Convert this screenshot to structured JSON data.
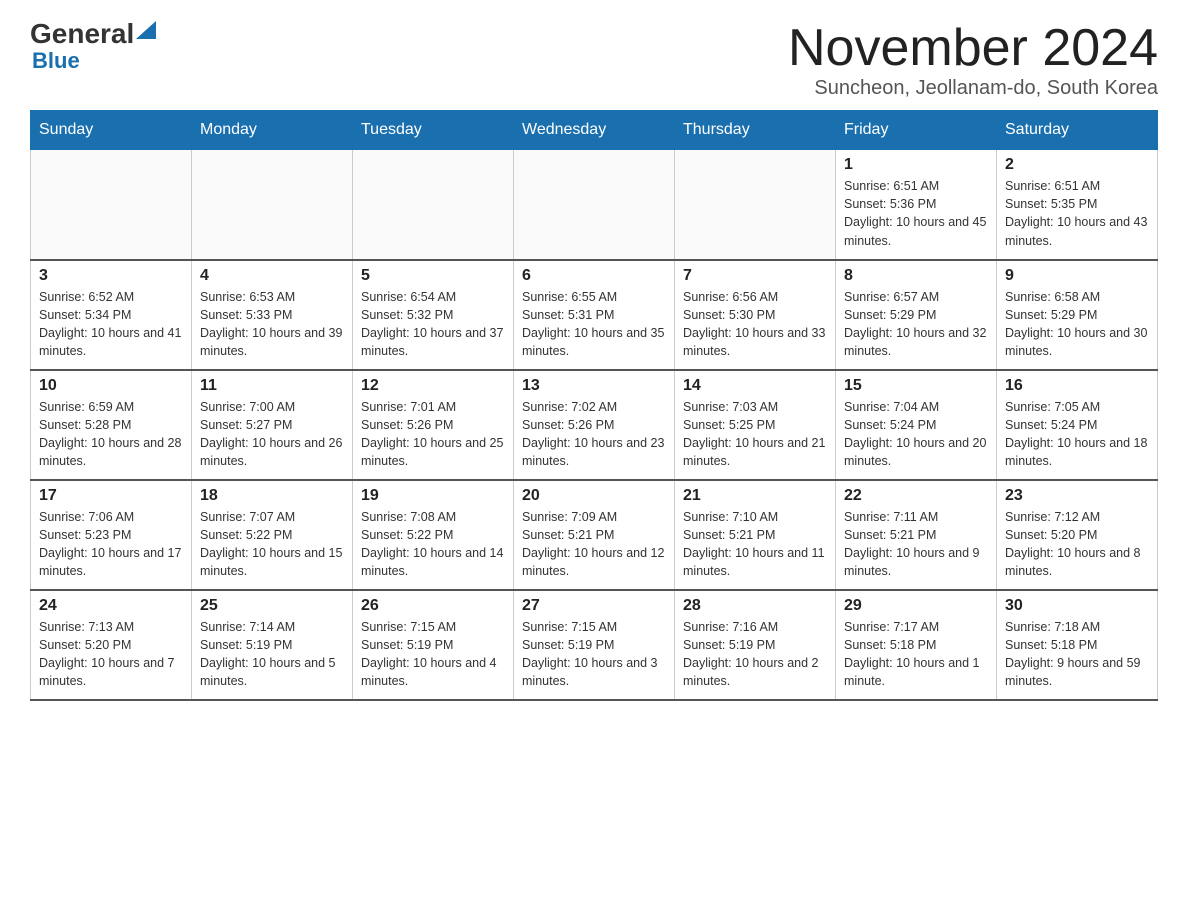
{
  "header": {
    "logo_general": "General",
    "logo_blue": "Blue",
    "month_title": "November 2024",
    "subtitle": "Suncheon, Jeollanam-do, South Korea"
  },
  "weekdays": [
    "Sunday",
    "Monday",
    "Tuesday",
    "Wednesday",
    "Thursday",
    "Friday",
    "Saturday"
  ],
  "weeks": [
    [
      {
        "day": "",
        "info": ""
      },
      {
        "day": "",
        "info": ""
      },
      {
        "day": "",
        "info": ""
      },
      {
        "day": "",
        "info": ""
      },
      {
        "day": "",
        "info": ""
      },
      {
        "day": "1",
        "info": "Sunrise: 6:51 AM\nSunset: 5:36 PM\nDaylight: 10 hours and 45 minutes."
      },
      {
        "day": "2",
        "info": "Sunrise: 6:51 AM\nSunset: 5:35 PM\nDaylight: 10 hours and 43 minutes."
      }
    ],
    [
      {
        "day": "3",
        "info": "Sunrise: 6:52 AM\nSunset: 5:34 PM\nDaylight: 10 hours and 41 minutes."
      },
      {
        "day": "4",
        "info": "Sunrise: 6:53 AM\nSunset: 5:33 PM\nDaylight: 10 hours and 39 minutes."
      },
      {
        "day": "5",
        "info": "Sunrise: 6:54 AM\nSunset: 5:32 PM\nDaylight: 10 hours and 37 minutes."
      },
      {
        "day": "6",
        "info": "Sunrise: 6:55 AM\nSunset: 5:31 PM\nDaylight: 10 hours and 35 minutes."
      },
      {
        "day": "7",
        "info": "Sunrise: 6:56 AM\nSunset: 5:30 PM\nDaylight: 10 hours and 33 minutes."
      },
      {
        "day": "8",
        "info": "Sunrise: 6:57 AM\nSunset: 5:29 PM\nDaylight: 10 hours and 32 minutes."
      },
      {
        "day": "9",
        "info": "Sunrise: 6:58 AM\nSunset: 5:29 PM\nDaylight: 10 hours and 30 minutes."
      }
    ],
    [
      {
        "day": "10",
        "info": "Sunrise: 6:59 AM\nSunset: 5:28 PM\nDaylight: 10 hours and 28 minutes."
      },
      {
        "day": "11",
        "info": "Sunrise: 7:00 AM\nSunset: 5:27 PM\nDaylight: 10 hours and 26 minutes."
      },
      {
        "day": "12",
        "info": "Sunrise: 7:01 AM\nSunset: 5:26 PM\nDaylight: 10 hours and 25 minutes."
      },
      {
        "day": "13",
        "info": "Sunrise: 7:02 AM\nSunset: 5:26 PM\nDaylight: 10 hours and 23 minutes."
      },
      {
        "day": "14",
        "info": "Sunrise: 7:03 AM\nSunset: 5:25 PM\nDaylight: 10 hours and 21 minutes."
      },
      {
        "day": "15",
        "info": "Sunrise: 7:04 AM\nSunset: 5:24 PM\nDaylight: 10 hours and 20 minutes."
      },
      {
        "day": "16",
        "info": "Sunrise: 7:05 AM\nSunset: 5:24 PM\nDaylight: 10 hours and 18 minutes."
      }
    ],
    [
      {
        "day": "17",
        "info": "Sunrise: 7:06 AM\nSunset: 5:23 PM\nDaylight: 10 hours and 17 minutes."
      },
      {
        "day": "18",
        "info": "Sunrise: 7:07 AM\nSunset: 5:22 PM\nDaylight: 10 hours and 15 minutes."
      },
      {
        "day": "19",
        "info": "Sunrise: 7:08 AM\nSunset: 5:22 PM\nDaylight: 10 hours and 14 minutes."
      },
      {
        "day": "20",
        "info": "Sunrise: 7:09 AM\nSunset: 5:21 PM\nDaylight: 10 hours and 12 minutes."
      },
      {
        "day": "21",
        "info": "Sunrise: 7:10 AM\nSunset: 5:21 PM\nDaylight: 10 hours and 11 minutes."
      },
      {
        "day": "22",
        "info": "Sunrise: 7:11 AM\nSunset: 5:21 PM\nDaylight: 10 hours and 9 minutes."
      },
      {
        "day": "23",
        "info": "Sunrise: 7:12 AM\nSunset: 5:20 PM\nDaylight: 10 hours and 8 minutes."
      }
    ],
    [
      {
        "day": "24",
        "info": "Sunrise: 7:13 AM\nSunset: 5:20 PM\nDaylight: 10 hours and 7 minutes."
      },
      {
        "day": "25",
        "info": "Sunrise: 7:14 AM\nSunset: 5:19 PM\nDaylight: 10 hours and 5 minutes."
      },
      {
        "day": "26",
        "info": "Sunrise: 7:15 AM\nSunset: 5:19 PM\nDaylight: 10 hours and 4 minutes."
      },
      {
        "day": "27",
        "info": "Sunrise: 7:15 AM\nSunset: 5:19 PM\nDaylight: 10 hours and 3 minutes."
      },
      {
        "day": "28",
        "info": "Sunrise: 7:16 AM\nSunset: 5:19 PM\nDaylight: 10 hours and 2 minutes."
      },
      {
        "day": "29",
        "info": "Sunrise: 7:17 AM\nSunset: 5:18 PM\nDaylight: 10 hours and 1 minute."
      },
      {
        "day": "30",
        "info": "Sunrise: 7:18 AM\nSunset: 5:18 PM\nDaylight: 9 hours and 59 minutes."
      }
    ]
  ]
}
